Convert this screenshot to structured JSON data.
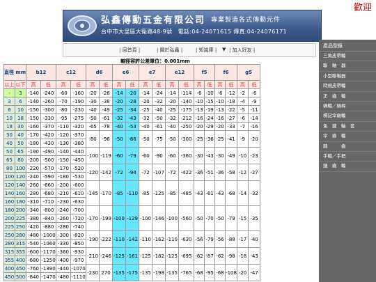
{
  "header": {
    "company": "弘鑫傳動五金有限公司",
    "slogan": "專業製造各式傳動元件",
    "contact": "台中市大里區大衛路48-9號　電話:04-24071615 傳真:04-24076171",
    "welcome": "歡迎",
    "colors": {
      "banner": "#3d5a8c",
      "welcome": "#cc0000"
    }
  },
  "tabs": [
    "回首頁",
    "關於弘鑫",
    "知識庫",
    "▼",
    "加入好友"
  ],
  "table": {
    "title": "軸徑容許公差單位：0.001mm",
    "size_label": "直徑 mm",
    "over_label": "以上",
    "under_label": "以下",
    "columns": [
      "b12",
      "c12",
      "d6",
      "e6",
      "e7",
      "e12",
      "f5",
      "f6",
      "g5"
    ],
    "hi": "高",
    "lo": "低",
    "rows": [
      {
        "sizes": [
          "-",
          "3"
        ],
        "vals": [
          [
            "-140",
            "-240"
          ],
          [
            "-60",
            "-160"
          ],
          [
            "-20",
            "-26"
          ],
          [
            "-14",
            "-20"
          ],
          [
            "-14",
            "-24"
          ],
          [
            "-14",
            "-114"
          ],
          [
            "-6",
            "-10"
          ],
          [
            "-6",
            "-12"
          ],
          [
            "-2",
            "-6"
          ]
        ]
      },
      {
        "sizes": [
          "3",
          "6"
        ],
        "vals": [
          [
            "-140",
            "-260"
          ],
          [
            "-70",
            "-190"
          ],
          [
            "-30",
            "-38"
          ],
          [
            "-20",
            "-28"
          ],
          [
            "-20",
            "-32"
          ],
          [
            "-20",
            "-140"
          ],
          [
            "-10",
            "-15"
          ],
          [
            "-10",
            "-18"
          ],
          [
            "-4",
            "-9"
          ]
        ]
      },
      {
        "sizes": [
          "6",
          "10"
        ],
        "vals": [
          [
            "-150",
            "-300"
          ],
          [
            "-80",
            "-230"
          ],
          [
            "-40",
            "-49"
          ],
          [
            "-25",
            "-34"
          ],
          [
            "-25",
            "-40"
          ],
          [
            "-25",
            "-175"
          ],
          [
            "-13",
            "-19"
          ],
          [
            "-13",
            "-22"
          ],
          [
            "-5",
            "-11"
          ]
        ]
      },
      {
        "sizes": [
          "10",
          "18"
        ],
        "vals": [
          [
            "-150",
            "-330"
          ],
          [
            "-95",
            "-275"
          ],
          [
            "-50",
            "-61"
          ],
          [
            "-32",
            "-43"
          ],
          [
            "-32",
            "-50"
          ],
          [
            "-32",
            "-212"
          ],
          [
            "-16",
            "-24"
          ],
          [
            "-16",
            "-27"
          ],
          [
            "-6",
            "-14"
          ]
        ]
      },
      {
        "sizes": [
          "18",
          "30"
        ],
        "vals": [
          [
            "-160",
            "-370"
          ],
          [
            "-110",
            "-320"
          ],
          [
            "-65",
            "-78"
          ],
          [
            "-40",
            "-53"
          ],
          [
            "-40",
            "-61"
          ],
          [
            "-40",
            "-250"
          ],
          [
            "-20",
            "-29"
          ],
          [
            "-20",
            "-33"
          ],
          [
            "-7",
            "-16"
          ]
        ]
      },
      {
        "sizes": [
          "30",
          "40"
        ],
        "vals": [
          [
            "-170",
            "-420"
          ],
          [
            "-120",
            "-370"
          ]
        ]
      },
      {
        "sizes": [
          "40",
          "50"
        ],
        "vals": [
          [
            "-180",
            "-430"
          ],
          [
            "-130",
            "-380"
          ]
        ]
      },
      {
        "sizes": [
          "50",
          "65"
        ],
        "vals": [
          [
            "-190",
            "-490"
          ],
          [
            "-140",
            "-440"
          ]
        ]
      },
      {
        "sizes": [
          "65",
          "80"
        ],
        "vals": [
          [
            "-200",
            "-500"
          ],
          [
            "-150",
            "-450"
          ]
        ]
      },
      {
        "sizes": [
          "80",
          "100"
        ],
        "vals": [
          [
            "-220",
            "-570"
          ],
          [
            "-170",
            "-520"
          ]
        ]
      },
      {
        "sizes": [
          "100",
          "120"
        ],
        "vals": [
          [
            "-240",
            "-590"
          ],
          [
            "-180",
            "-530"
          ]
        ]
      },
      {
        "sizes": [
          "120",
          "140"
        ],
        "vals": [
          [
            "-260",
            "-660"
          ],
          [
            "-200",
            "-600"
          ]
        ]
      },
      {
        "sizes": [
          "140",
          "160"
        ],
        "vals": [
          [
            "-280",
            "-680"
          ],
          [
            "-210",
            "-610"
          ]
        ]
      },
      {
        "sizes": [
          "160",
          "180"
        ],
        "vals": [
          [
            "-310",
            "-710"
          ],
          [
            "-230",
            "-630"
          ]
        ]
      },
      {
        "sizes": [
          "180",
          "200"
        ],
        "vals": [
          [
            "-340",
            "-800"
          ],
          [
            "-240",
            "-700"
          ]
        ]
      },
      {
        "sizes": [
          "200",
          "225"
        ],
        "vals": [
          [
            "-380",
            "-840"
          ],
          [
            "-260",
            "-720"
          ]
        ]
      },
      {
        "sizes": [
          "225",
          "250"
        ],
        "vals": [
          [
            "-420",
            "-880"
          ],
          [
            "-280",
            "-740"
          ]
        ]
      },
      {
        "sizes": [
          "250",
          "280"
        ],
        "vals": [
          [
            "-480",
            "-1000"
          ],
          [
            "-300",
            "-820"
          ]
        ]
      },
      {
        "sizes": [
          "280",
          "315"
        ],
        "vals": [
          [
            "-540",
            "-1060"
          ],
          [
            "-330",
            "-850"
          ]
        ]
      },
      {
        "sizes": [
          "315",
          "355"
        ],
        "vals": [
          [
            "-600",
            "-1170"
          ],
          [
            "-360",
            "-930"
          ]
        ]
      },
      {
        "sizes": [
          "355",
          "400"
        ],
        "vals": [
          [
            "-680",
            "-1250"
          ],
          [
            "-400",
            "-970"
          ]
        ]
      },
      {
        "sizes": [
          "400",
          "450"
        ],
        "vals": [
          [
            "-760",
            "-1390"
          ],
          [
            "-440",
            "-1070"
          ]
        ]
      },
      {
        "sizes": [
          "450",
          "500"
        ],
        "vals": [
          [
            "-840",
            "-1470"
          ],
          [
            "-480",
            "-1110"
          ]
        ]
      }
    ],
    "merged": [
      {
        "start": 5,
        "span": 2,
        "vals": [
          [
            "-80",
            "-96"
          ],
          [
            "-50",
            "-66"
          ],
          [
            "-50",
            "-75"
          ],
          [
            "-50",
            "-300"
          ],
          [
            "-25",
            "-36"
          ],
          [
            "-25",
            "-41"
          ],
          [
            "-9",
            "-20"
          ]
        ]
      },
      {
        "start": 7,
        "span": 2,
        "vals": [
          [
            "-100",
            "-119"
          ],
          [
            "-60",
            "-79"
          ],
          [
            "-60",
            "-90"
          ],
          [
            "-60",
            "-360"
          ],
          [
            "-30",
            "-43"
          ],
          [
            "-30",
            "-49"
          ],
          [
            "-10",
            "-23"
          ]
        ]
      },
      {
        "start": 9,
        "span": 2,
        "vals": [
          [
            "-120",
            "-142"
          ],
          [
            "-72",
            "-94"
          ],
          [
            "-72",
            "-107"
          ],
          [
            "-72",
            "-422"
          ],
          [
            "-36",
            "-51"
          ],
          [
            "-36",
            "-58"
          ],
          [
            "-12",
            "-27"
          ]
        ]
      },
      {
        "start": 11,
        "span": 3,
        "vals": [
          [
            "-145",
            "-170"
          ],
          [
            "-85",
            "-110"
          ],
          [
            "-85",
            "-125"
          ],
          [
            "-85",
            "-485"
          ],
          [
            "-43",
            "-61"
          ],
          [
            "-43",
            "-68"
          ],
          [
            "-14",
            "-32"
          ]
        ]
      },
      {
        "start": 14,
        "span": 3,
        "vals": [
          [
            "-170",
            "-199"
          ],
          [
            "-100",
            "-129"
          ],
          [
            "-100",
            "-146"
          ],
          [
            "-100",
            "-560"
          ],
          [
            "-50",
            "-70"
          ],
          [
            "-50",
            "-79"
          ],
          [
            "-15",
            "-35"
          ]
        ]
      },
      {
        "start": 17,
        "span": 2,
        "vals": [
          [
            "-190",
            "-222"
          ],
          [
            "-110",
            "-142"
          ],
          [
            "-110",
            "-162"
          ],
          [
            "-110",
            "-630"
          ],
          [
            "-56",
            "-79"
          ],
          [
            "-56",
            "-88"
          ],
          [
            "-17",
            "-40"
          ]
        ]
      },
      {
        "start": 19,
        "span": 2,
        "vals": [
          [
            "-210",
            "-246"
          ],
          [
            "-125",
            "-161"
          ],
          [
            "-125",
            "-182"
          ],
          [
            "-125",
            "-695"
          ],
          [
            "-62",
            "-87"
          ],
          [
            "-62",
            "-98"
          ],
          [
            "-18",
            "-43"
          ]
        ]
      },
      {
        "start": 21,
        "span": 2,
        "vals": [
          [
            "-230",
            "270"
          ],
          [
            "-135",
            "-175"
          ],
          [
            "-135",
            "-198"
          ],
          [
            "-135",
            "-765"
          ],
          [
            "-68",
            "-95"
          ],
          [
            "-68",
            "-108"
          ],
          [
            "-20",
            "-47"
          ]
        ]
      }
    ]
  },
  "sidebar": {
    "title": "產品型錄",
    "items": [
      "三角皮帶輪",
      "聯　軸　器",
      "小型聯軸器",
      "時規皮帶輪",
      "正　齒　輪",
      "蝸輪／蝸桿",
      "標記伞齒輪",
      "免　鍵　軸　套",
      "伞　齒　輪",
      "棘　　　齒",
      "手輪／手把",
      "鏈　齒　輪"
    ]
  }
}
